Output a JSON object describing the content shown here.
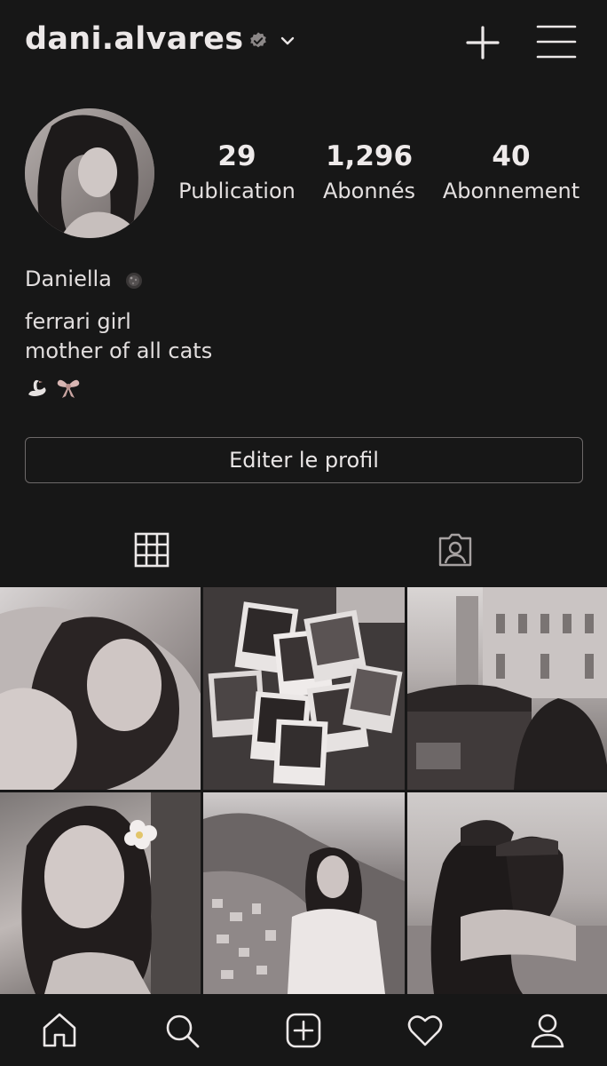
{
  "header": {
    "username": "dani.alvares",
    "icons": {
      "verified": "verified-badge-icon",
      "dropdown": "chevron-down-icon",
      "new_post": "plus-icon",
      "menu": "hamburger-menu-icon"
    }
  },
  "profile": {
    "stats": [
      {
        "value": "29",
        "label": "Publication"
      },
      {
        "value": "1,296",
        "label": "Abonnés"
      },
      {
        "value": "40",
        "label": "Abonnement"
      }
    ],
    "display_name": "Daniella",
    "bio_lines": [
      "ferrari girl",
      "mother of all cats"
    ],
    "emoji_icons": [
      "swan-icon",
      "ribbon-bow-icon"
    ],
    "edit_button_label": "Editer le profil"
  },
  "tabs": [
    {
      "icon": "grid-icon",
      "active": true
    },
    {
      "icon": "tagged-person-icon",
      "active": false
    }
  ],
  "posts": [
    {
      "name": "post-selfie-lying"
    },
    {
      "name": "post-polaroids"
    },
    {
      "name": "post-vintage-car-street"
    },
    {
      "name": "post-flower-hair-portrait"
    },
    {
      "name": "post-coastal-village"
    },
    {
      "name": "post-couple-hug"
    }
  ],
  "bottom_nav": [
    {
      "icon": "home-icon"
    },
    {
      "icon": "search-icon"
    },
    {
      "icon": "add-post-icon"
    },
    {
      "icon": "heart-icon"
    },
    {
      "icon": "profile-icon"
    }
  ],
  "colors": {
    "background": "#171717",
    "text": "#e9e5e5",
    "button_border": "#6d6969"
  }
}
